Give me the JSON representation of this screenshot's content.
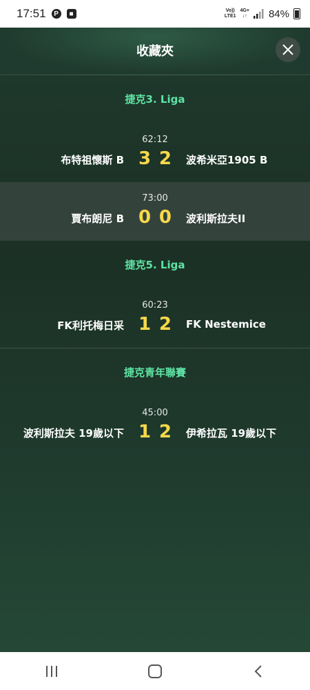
{
  "status_bar": {
    "time": "17:51",
    "icons": [
      "p-icon",
      "square-icon"
    ],
    "network_top": "Vo))",
    "network_bottom": "LTE1",
    "network_type": "4G+",
    "battery": "84%"
  },
  "header": {
    "title": "收藏夾",
    "close_icon": "close-icon"
  },
  "leagues": [
    {
      "name": "捷克3. Liga",
      "matches": [
        {
          "clock": "62:12",
          "home": "布特祖懷斯 B",
          "home_score": "3",
          "away_score": "2",
          "away": "波希米亞1905 B"
        },
        {
          "clock": "73:00",
          "home": "賈布朗尼 B",
          "home_score": "0",
          "away_score": "0",
          "away": "波利斯拉夫II"
        }
      ]
    },
    {
      "name": "捷克5. Liga",
      "matches": [
        {
          "clock": "60:23",
          "home": "FK利托梅日采",
          "home_score": "1",
          "away_score": "2",
          "away": "FK Nestemice"
        }
      ]
    },
    {
      "name": "捷克青年聯賽",
      "matches": [
        {
          "clock": "45:00",
          "home": "波利斯拉夫 19歲以下",
          "home_score": "1",
          "away_score": "2",
          "away": "伊希拉瓦 19歲以下"
        }
      ]
    }
  ],
  "nav_bar": {
    "icons": [
      "recents-icon",
      "home-icon",
      "back-icon"
    ]
  },
  "colors": {
    "league_title": "#5ee3a3",
    "score": "#f6d84a",
    "background": "#1f3a2e",
    "highlight_row": "#34423c"
  }
}
